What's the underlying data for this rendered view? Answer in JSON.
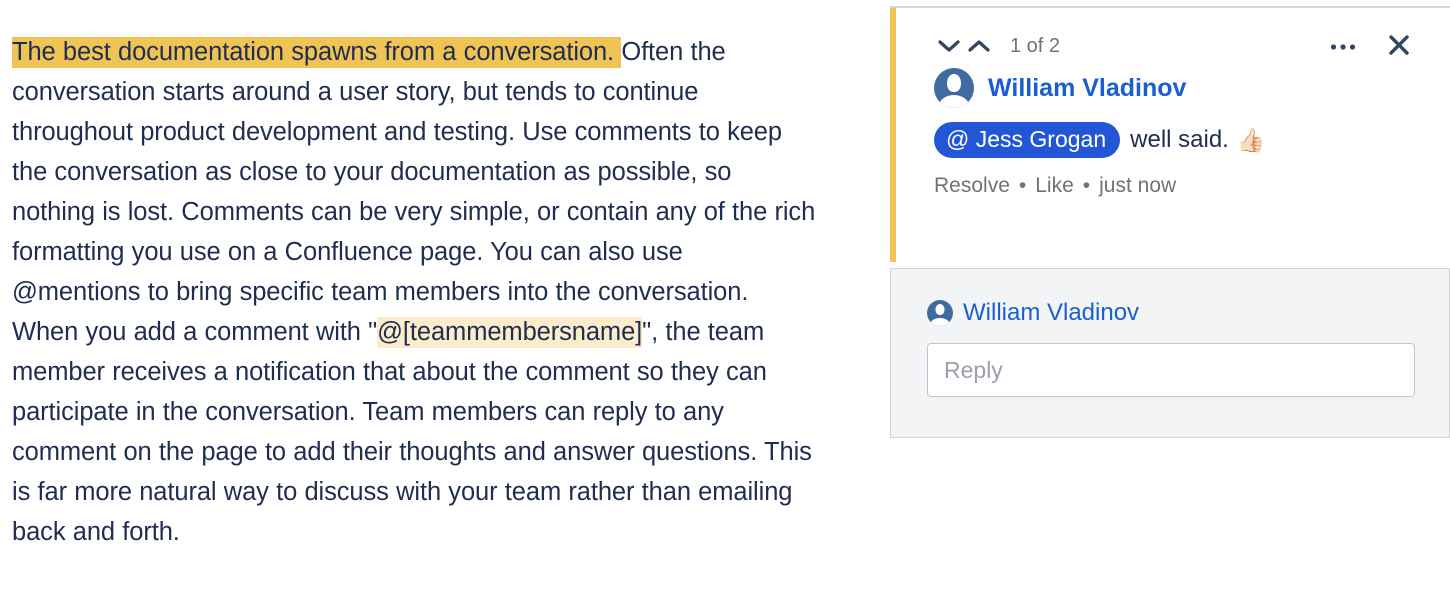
{
  "article": {
    "segments": [
      {
        "type": "highlight-strong",
        "text": "The best documentation spawns from a conversation. "
      },
      {
        "type": "plain",
        "text": "Often the conversation starts around a user story, but tends to continue throughout product development and testing. Use comments to keep the conversation as close to your documentation as possible, so nothing is lost. Comments can be very simple, or contain any of the rich formatting you use on a Confluence page. You can also use @mentions to bring specific team members into the conversation. When you add a comment with \""
      },
      {
        "type": "highlight-soft",
        "text": "@[teammembersname]"
      },
      {
        "type": "plain",
        "text": "\", the team member receives a notification that about the comment so they can participate in the conversation. Team members can reply to any comment on the page to add their thoughts and answer questions. This is far more natural way to discuss with your team rather than emailing back and forth."
      }
    ],
    "part1": "The best documentation spawns from a conversation. ",
    "part2": "Often the conversation starts around a user story, but tends to continue throughout product development and testing. Use comments to keep the conversation as close to your documentation as possible, so nothing is lost. Comments can be very simple, or contain any of the rich formatting you use on a Confluence page. You can also use @mentions to bring specific team members into the conversation. When you add a comment with \"",
    "part3": "@[teammembersname]",
    "part4": "\", the team member receives a notification that about the comment so they can participate in the conversation. Team members can reply to any comment on the page to add their thoughts and answer questions. This is far more natural way to discuss with your team rather than emailing back and forth."
  },
  "comment_panel": {
    "toolbar": {
      "prev_icon": "chevron-down-icon",
      "next_icon": "chevron-up-icon",
      "page_indicator": "1 of 2",
      "more_icon": "ellipsis-icon",
      "close_icon": "close-icon"
    },
    "comment": {
      "author": "William Vladinov",
      "avatar_icon": "user-avatar-icon",
      "mention": "@ Jess Grogan",
      "text": "well said.",
      "emoji": "👍🏻",
      "actions": {
        "resolve": "Resolve",
        "like": "Like",
        "separator": "•",
        "timestamp": "just now"
      }
    },
    "reply": {
      "author": "William Vladinov",
      "avatar_icon": "user-avatar-icon",
      "input_value": "",
      "input_placeholder": "Reply"
    }
  },
  "colors": {
    "highlight_strong": "#efc454",
    "highlight_soft": "#fbeccc",
    "accent_bar": "#efc454",
    "link_blue": "#1b5ed0",
    "mention_blue": "#2356d6",
    "text_navy": "#1f2d50",
    "muted_gray": "#6f7278",
    "panel_gray": "#f3f4f5",
    "border_gray": "#d2d4d8"
  }
}
